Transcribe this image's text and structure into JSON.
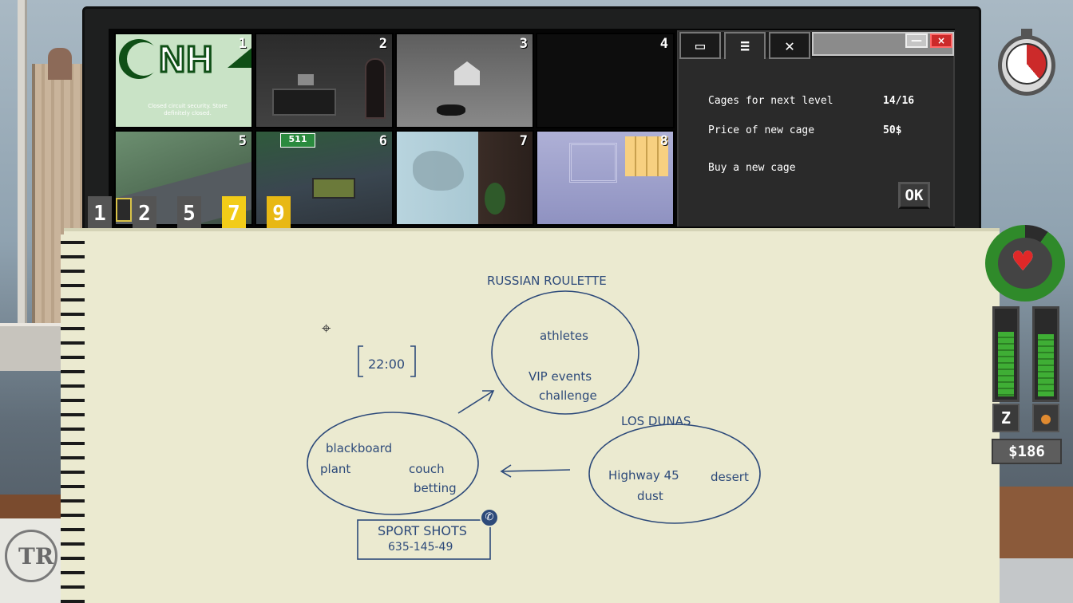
{
  "cameras": [
    {
      "num": "1",
      "logo_text": "NH",
      "caption": "Closed circuit security. Store definitely closed."
    },
    {
      "num": "2"
    },
    {
      "num": "3"
    },
    {
      "num": "4"
    },
    {
      "num": "5"
    },
    {
      "num": "6",
      "sign_text": "511"
    },
    {
      "num": "7"
    },
    {
      "num": "8"
    }
  ],
  "camera_tabs": [
    "1",
    "2",
    "5",
    "7",
    "9"
  ],
  "window": {
    "tabs": [
      {
        "icon": "camera-icon",
        "label": "▭"
      },
      {
        "icon": "cage-icon",
        "label": "≡"
      },
      {
        "icon": "close-x-icon",
        "label": "✕"
      }
    ],
    "minimize": "—",
    "close": "×",
    "rows": [
      {
        "label": "Cages for next level",
        "value": "14/16"
      },
      {
        "label": "Price of new cage",
        "value": "50$"
      },
      {
        "label": "Buy a new cage",
        "value": ""
      }
    ],
    "ok_label": "OK"
  },
  "notes": {
    "roulette_title": "RUSSIAN ROULETTE",
    "roulette_items": [
      "athletes",
      "VIP events",
      "challenge"
    ],
    "time": "22:00",
    "room_items": [
      "blackboard",
      "plant",
      "couch",
      "betting"
    ],
    "dunas_title": "LOS DUNAS",
    "dunas_items": [
      "Highway 45",
      "desert",
      "dust"
    ],
    "sport_title": "SPORT SHOTS",
    "sport_phone": "635-145-49"
  },
  "hud": {
    "money": "$186",
    "sleep_level": 0.75,
    "food_level": 0.72,
    "health_level": 0.9,
    "timer_level": 0.39,
    "colors": {
      "accent_yellow": "#f2cc18",
      "health_green": "#2f8a2a",
      "ink_blue": "#2d4a7a",
      "danger_red": "#cc2a2a"
    }
  }
}
